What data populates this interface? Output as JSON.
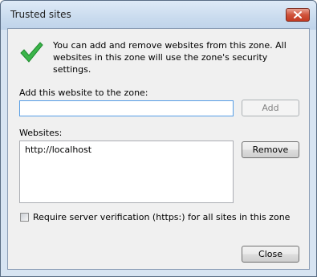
{
  "window": {
    "title": "Trusted sites"
  },
  "info": {
    "icon": "green-check-icon",
    "text": "You can add and remove websites from this zone. All websites in this zone will use the zone's security settings."
  },
  "add_section": {
    "label": "Add this website to the zone:",
    "input_value": "",
    "add_button": "Add"
  },
  "websites": {
    "label": "Websites:",
    "items": [
      "http://localhost"
    ],
    "remove_button": "Remove"
  },
  "verification": {
    "label": "Require server verification (https:) for all sites in this zone",
    "checked": false
  },
  "footer": {
    "close_button": "Close"
  },
  "colors": {
    "check_green": "#3bb54a",
    "close_red": "#c94a33"
  }
}
